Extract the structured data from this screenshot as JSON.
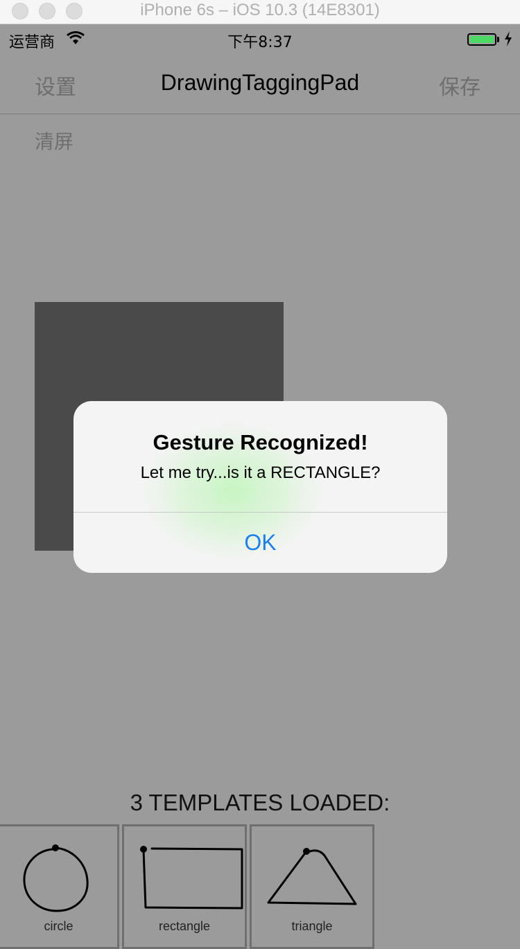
{
  "simulator": {
    "title": "iPhone 6s – iOS 10.3 (14E8301)"
  },
  "status_bar": {
    "carrier": "运营商",
    "time": "下午8:37",
    "battery_level": 1.0,
    "battery_color": "#4cd964"
  },
  "nav": {
    "left_label": "设置",
    "title": "DrawingTaggingPad",
    "right_label": "保存"
  },
  "toolbar": {
    "clear_label": "清屏"
  },
  "alert": {
    "title": "Gesture Recognized!",
    "message": "Let me try...is it a RECTANGLE?",
    "ok_label": "OK",
    "ok_color": "#1b7ff5"
  },
  "templates": {
    "heading": "3 TEMPLATES LOADED:",
    "items": [
      {
        "label": "circle",
        "icon": "circle-gesture-icon"
      },
      {
        "label": "rectangle",
        "icon": "rectangle-gesture-icon"
      },
      {
        "label": "triangle",
        "icon": "triangle-gesture-icon"
      }
    ]
  }
}
